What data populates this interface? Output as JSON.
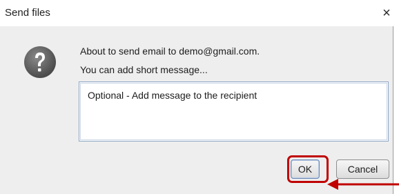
{
  "window": {
    "title": "Send files",
    "close_glyph": "×"
  },
  "dialog": {
    "icon": "question-icon",
    "message_line1": "About to send email to demo@gmail.com.",
    "message_line2": "You can add short message...",
    "message_field_value": "Optional - Add message to the recipient"
  },
  "buttons": {
    "ok_label": "OK",
    "cancel_label": "Cancel"
  },
  "annotation": {
    "highlight_color": "#c00000",
    "arrow_color": "#c00000"
  }
}
